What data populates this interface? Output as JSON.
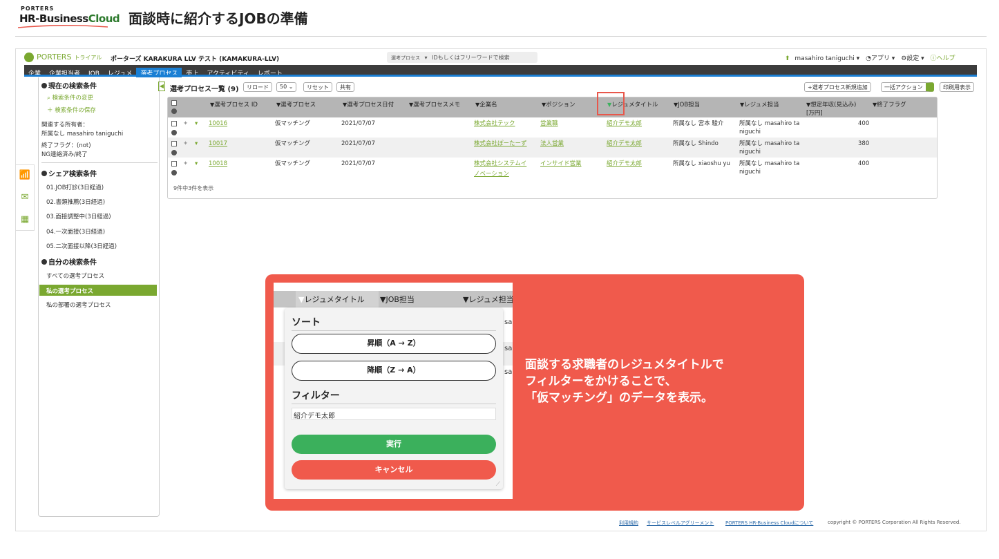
{
  "header": {
    "logo_top": "PORTERS",
    "logo_main_1": "HR-Business",
    "logo_main_2": "Cloud",
    "page_title": "面談時に紹介するJOBの準備"
  },
  "app": {
    "brand": "PORTERS",
    "brand_tag": "トライアル",
    "account": "ポーターズ KARAKURA LLV テスト (KAMAKURA-LLV)",
    "search_scope": "選考プロセス",
    "search_placeholder": "IDもしくはフリーワードで検索",
    "user": "masahiro taniguchi ▾",
    "apps": "アプリ ▾",
    "settings": "設定 ▾",
    "help": "ヘルプ",
    "menu": [
      "企業",
      "企業担当者",
      "JOB",
      "レジュメ",
      "選考プロセス",
      "売上",
      "アクティビティ",
      "レポート"
    ],
    "menu_active_index": 4
  },
  "sidebar": {
    "current_title": "現在の検索条件",
    "change_link": "検索条件の変更",
    "save_link": "検索条件の保存",
    "meta_1": "関連する所有者：",
    "meta_2": "所属なし masahiro taniguchi",
    "meta_3": "終了フラグ：(not)",
    "meta_4": "NG連絡済み/終了",
    "share_title": "シェア検索条件",
    "share_items": [
      "01.JOB打診(3日経過)",
      "02.書類推薦(3日経過)",
      "03.面接調整中(3日経過)",
      "04.一次面接(3日経過)",
      "05.二次面接以降(3日経過)"
    ],
    "mine_title": "自分の検索条件",
    "mine_items": [
      "すべての選考プロセス",
      "私の選考プロセス",
      "私の部署の選考プロセス"
    ]
  },
  "list": {
    "title": "選考プロセス一覧 (9)",
    "reload": "リロード",
    "per_page": "50 ⌄",
    "reset": "リセット",
    "share": "共有",
    "new_btn": "+選考プロセス新規追加",
    "bulk_btn": "一括アクション",
    "print_btn": "印刷用表示",
    "columns": [
      "選考プロセス ID",
      "選考プロセス",
      "選考プロセス日付",
      "選考プロセスメモ",
      "企業名",
      "ポジション",
      "レジュメタイトル",
      "JOB担当",
      "レジュメ担当",
      "想定年収(見込み)",
      "[万円]",
      "終了フラグ"
    ],
    "rows": [
      {
        "id": "10016",
        "process": "仮マッチング",
        "date": "2021/07/07",
        "company": "株式会社テック",
        "company2": "",
        "position": "営業職",
        "resume": "紹介デモ太郎",
        "job_owner": "所属なし 宮本 駿介",
        "resume_owner": "所属なし masahiro ta",
        "resume_owner2": "niguchi",
        "salary": "400"
      },
      {
        "id": "10017",
        "process": "仮マッチング",
        "date": "2021/07/07",
        "company": "株式会社ぽーたーず",
        "company2": "",
        "position": "法人営業",
        "resume": "紹介デモ太郎",
        "job_owner": "所属なし Shindo",
        "resume_owner": "所属なし masahiro ta",
        "resume_owner2": "niguchi",
        "salary": "380"
      },
      {
        "id": "10018",
        "process": "仮マッチング",
        "date": "2021/07/07",
        "company": "株式会社システムイ",
        "company2": "ノベーション",
        "position": "インサイド営業",
        "resume": "紹介デモ太郎",
        "job_owner": "所属なし xiaoshu yu",
        "resume_owner": "所属なし masahiro ta",
        "resume_owner2": "niguchi",
        "salary": "400"
      }
    ],
    "count_text": "9件中3件を表示"
  },
  "overlay": {
    "col_resume": "レジュメタイトル",
    "col_job": "JOB担当",
    "col_resume_owner": "レジュメ担当",
    "sort_title": "ソート",
    "asc": "昇順（A → Z）",
    "desc": "降順（Z → A）",
    "filter_title": "フィルター",
    "filter_value": "紹介デモ太郎",
    "run": "実行",
    "cancel": "キャンセル",
    "bg_frag": "sa",
    "msg_1": "面談する求職者のレジュメタイトルで",
    "msg_2": "フィルターをかけることで、",
    "msg_3": "「仮マッチング」のデータを表示。"
  },
  "footer": {
    "terms": "利用規約",
    "sla": "サービスレベルアグリーメント",
    "about": "PORTERS HR-Business Cloudについて",
    "copyright": "copyright © PORTERS Corporation All Rights Reserved."
  },
  "colors": {
    "accent_green": "#7aa830",
    "blue": "#1a7fd4",
    "coral": "#f05a4c",
    "run_green": "#3bb05c"
  }
}
